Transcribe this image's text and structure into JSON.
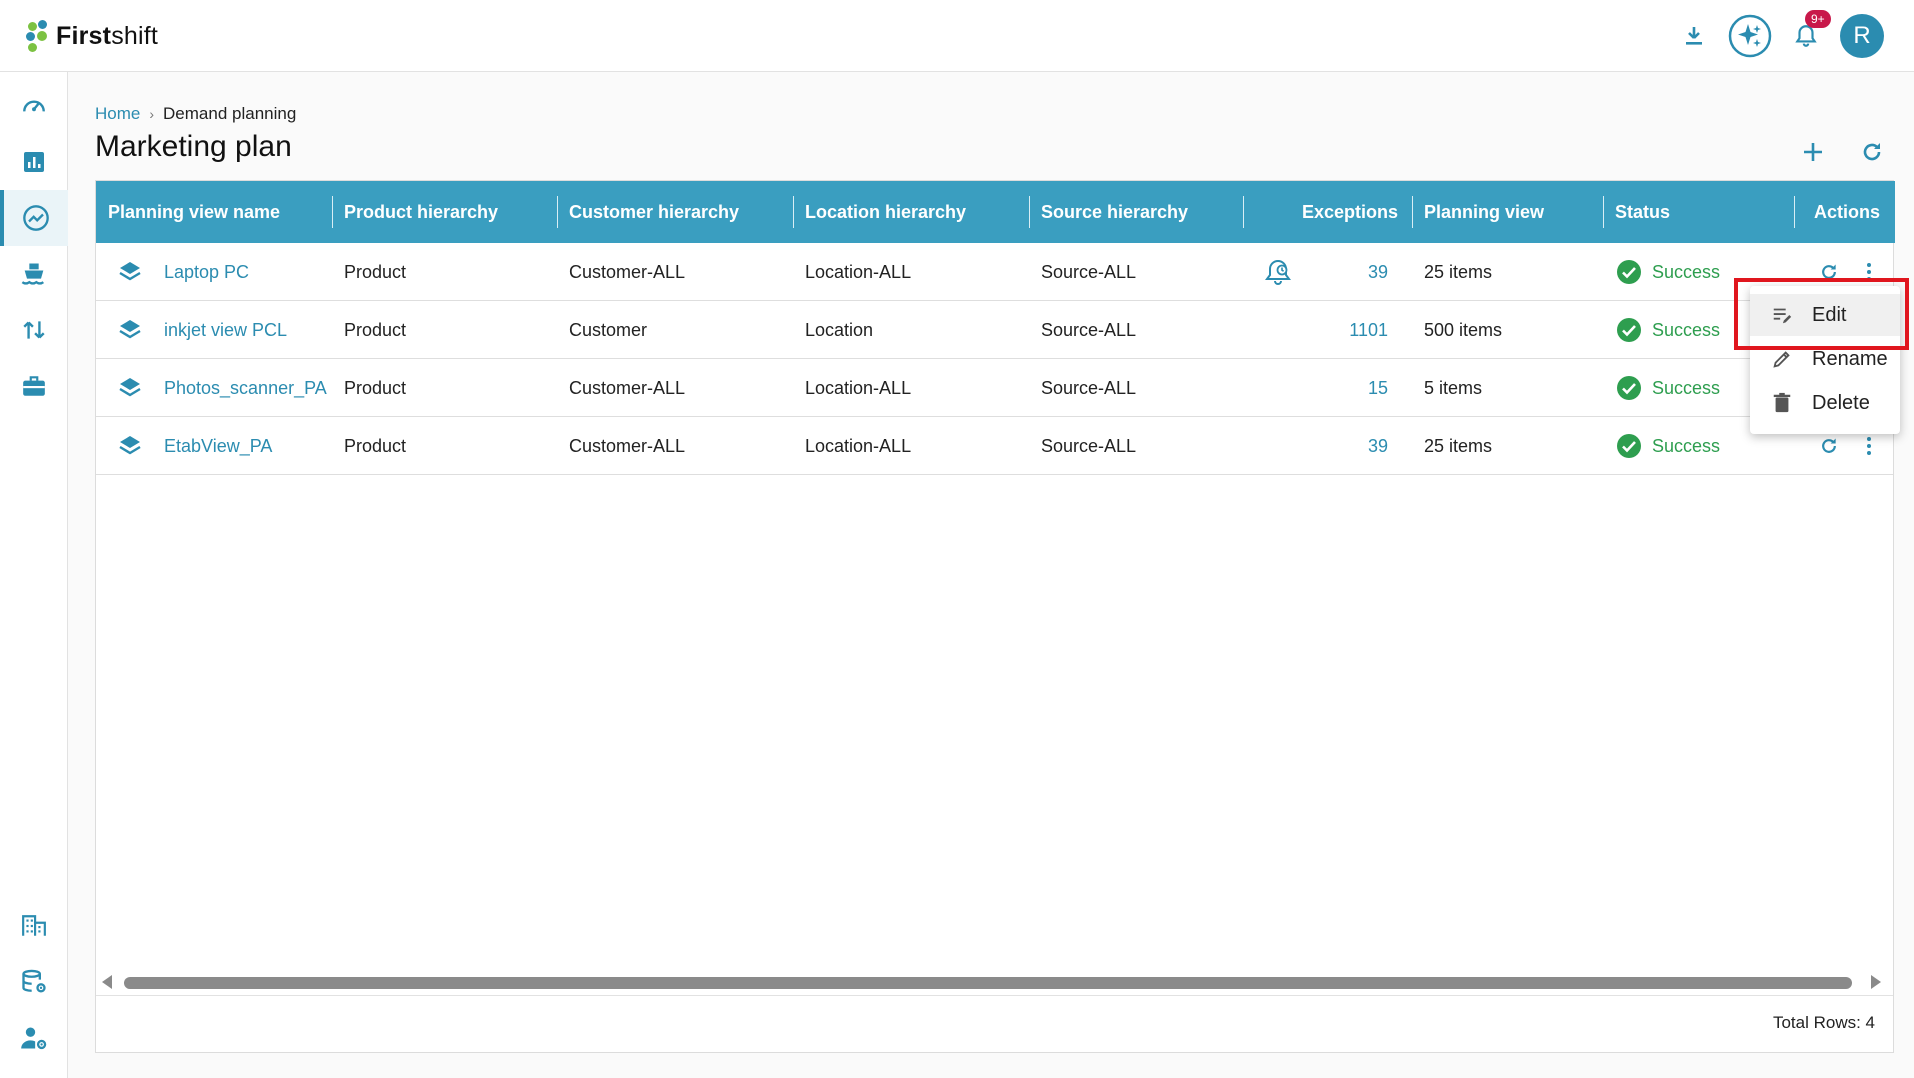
{
  "app": {
    "logo_bold": "First",
    "logo_light": "shift"
  },
  "topbar": {
    "icons": [
      "download-icon",
      "ai-sparkle-icon",
      "bell-icon"
    ],
    "notification_badge": "9+",
    "avatar_initial": "R"
  },
  "sidebar": {
    "items": [
      "dashboard-icon",
      "reports-icon",
      "demand-planning-icon",
      "shipping-icon",
      "sort-icon",
      "briefcase-icon",
      "building-icon",
      "database-settings-icon",
      "user-settings-icon"
    ],
    "active": "demand-planning-icon"
  },
  "breadcrumb": {
    "home": "Home",
    "current": "Demand planning",
    "separator": "›"
  },
  "page": {
    "title": "Marketing plan"
  },
  "table": {
    "headers": {
      "name": "Planning view name",
      "product": "Product hierarchy",
      "customer": "Customer hierarchy",
      "location": "Location hierarchy",
      "source": "Source hierarchy",
      "exceptions": "Exceptions",
      "planning_view": "Planning view",
      "status": "Status",
      "actions": "Actions"
    },
    "rows": [
      {
        "name": "Laptop PC",
        "product": "Product",
        "customer": "Customer-ALL",
        "location": "Location-ALL",
        "source": "Source-ALL",
        "exceptions": "39",
        "planning_view": "25 items",
        "status": "Success",
        "exception_alert": true
      },
      {
        "name": "inkjet view PCL",
        "product": "Product",
        "customer": "Customer",
        "location": "Location",
        "source": "Source-ALL",
        "exceptions": "1101",
        "planning_view": "500 items",
        "status": "Success",
        "exception_alert": false
      },
      {
        "name": "Photos_scanner_PA",
        "product": "Product",
        "customer": "Customer-ALL",
        "location": "Location-ALL",
        "source": "Source-ALL",
        "exceptions": "15",
        "planning_view": "5 items",
        "status": "Success",
        "exception_alert": false
      },
      {
        "name": "EtabView_PA",
        "product": "Product",
        "customer": "Customer-ALL",
        "location": "Location-ALL",
        "source": "Source-ALL",
        "exceptions": "39",
        "planning_view": "25 items",
        "status": "Success",
        "exception_alert": false
      }
    ],
    "footer": {
      "total_rows": "Total Rows: 4"
    }
  },
  "context_menu": {
    "items": [
      {
        "label": "Edit",
        "icon": "edit-list-icon"
      },
      {
        "label": "Rename",
        "icon": "pencil-icon"
      },
      {
        "label": "Delete",
        "icon": "trash-icon"
      }
    ]
  },
  "colors": {
    "accent": "#2b8cb0",
    "header_bg": "#3a9ec0",
    "success": "#2e9e4f",
    "badge": "#c8184a",
    "highlight": "#e0161e"
  }
}
